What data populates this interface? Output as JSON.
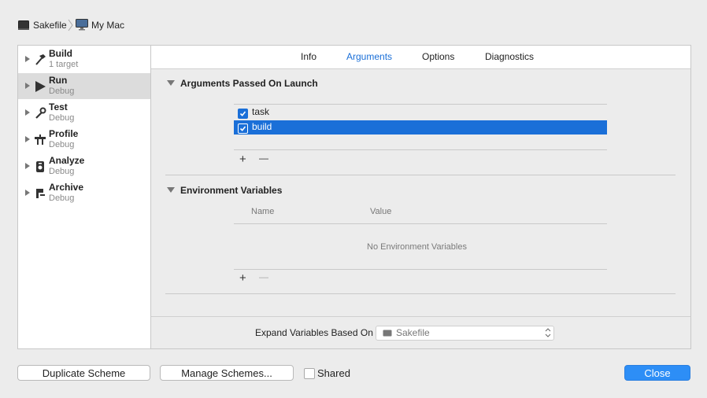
{
  "breadcrumb": {
    "project": "Sakefile",
    "destination": "My Mac"
  },
  "sidebar": {
    "items": [
      {
        "title": "Build",
        "subtitle": "1 target",
        "icon": "hammer-icon"
      },
      {
        "title": "Run",
        "subtitle": "Debug",
        "icon": "play-icon",
        "selected": true
      },
      {
        "title": "Test",
        "subtitle": "Debug",
        "icon": "wrench-icon"
      },
      {
        "title": "Profile",
        "subtitle": "Debug",
        "icon": "instruments-icon"
      },
      {
        "title": "Analyze",
        "subtitle": "Debug",
        "icon": "analyze-icon"
      },
      {
        "title": "Archive",
        "subtitle": "Debug",
        "icon": "archive-icon"
      }
    ]
  },
  "tabs": [
    {
      "label": "Info"
    },
    {
      "label": "Arguments",
      "active": true
    },
    {
      "label": "Options"
    },
    {
      "label": "Diagnostics"
    }
  ],
  "arguments_section": {
    "title": "Arguments Passed On Launch",
    "rows": [
      {
        "label": "task",
        "checked": true
      },
      {
        "label": "build",
        "checked": true,
        "selected": true
      }
    ],
    "add_label": "+",
    "remove_label": "—"
  },
  "env_section": {
    "title": "Environment Variables",
    "col_name": "Name",
    "col_value": "Value",
    "empty_message": "No Environment Variables",
    "add_label": "+",
    "remove_label": "—"
  },
  "expand_variables": {
    "label": "Expand Variables Based On",
    "value": "Sakefile"
  },
  "footer": {
    "duplicate_label": "Duplicate Scheme",
    "manage_label": "Manage Schemes...",
    "shared_label": "Shared",
    "shared_checked": false,
    "close_label": "Close"
  },
  "colors": {
    "accent": "#1a6fd8",
    "primary_button": "#2d8ef6"
  }
}
